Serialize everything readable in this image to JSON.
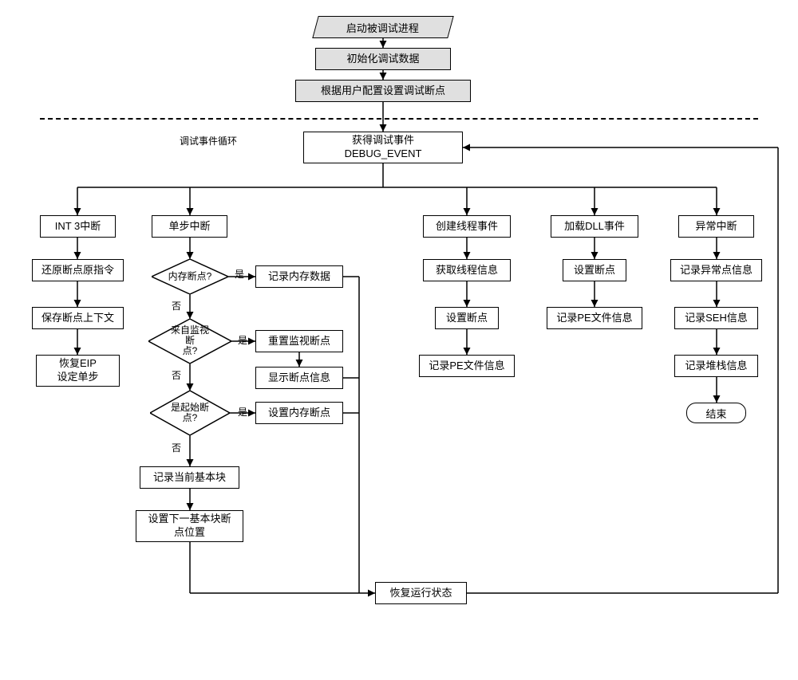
{
  "start": "启动被调试进程",
  "init": "初始化调试数据",
  "config": "根据用户配置设置调试断点",
  "loopLabel": "调试事件循环",
  "getEvent": "获得调试事件\nDEBUG_EVENT",
  "branches": {
    "int3": "INT 3中断",
    "singleStep": "单步中断",
    "createThread": "创建线程事件",
    "loadDll": "加载DLL事件",
    "exception": "异常中断"
  },
  "int3Steps": {
    "restore": "还原断点原指令",
    "saveCtx": "保存断点上下文",
    "recoverEip": "恢复EIP\n设定单步"
  },
  "singleStepDecisions": {
    "memBp": "内存断点?",
    "fromMonitor": "来自监视断\n点?",
    "isStartBp": "是起始断\n点?"
  },
  "singleStepActions": {
    "recordMem": "记录内存数据",
    "resetMonitor": "重置监视断点",
    "showBpInfo": "显示断点信息",
    "setMemBp": "设置内存断点",
    "recordBlock": "记录当前基本块",
    "setNextBp": "设置下一基本块断\n点位置"
  },
  "threadSteps": {
    "getInfo": "获取线程信息",
    "setBp": "设置断点",
    "recordPE": "记录PE文件信息"
  },
  "dllSteps": {
    "setBp": "设置断点",
    "recordPE": "记录PE文件信息"
  },
  "exceptionSteps": {
    "recordPoint": "记录异常点信息",
    "recordSEH": "记录SEH信息",
    "recordStack": "记录堆栈信息"
  },
  "end": "结束",
  "restoreRun": "恢复运行状态",
  "yes": "是",
  "no": "否"
}
